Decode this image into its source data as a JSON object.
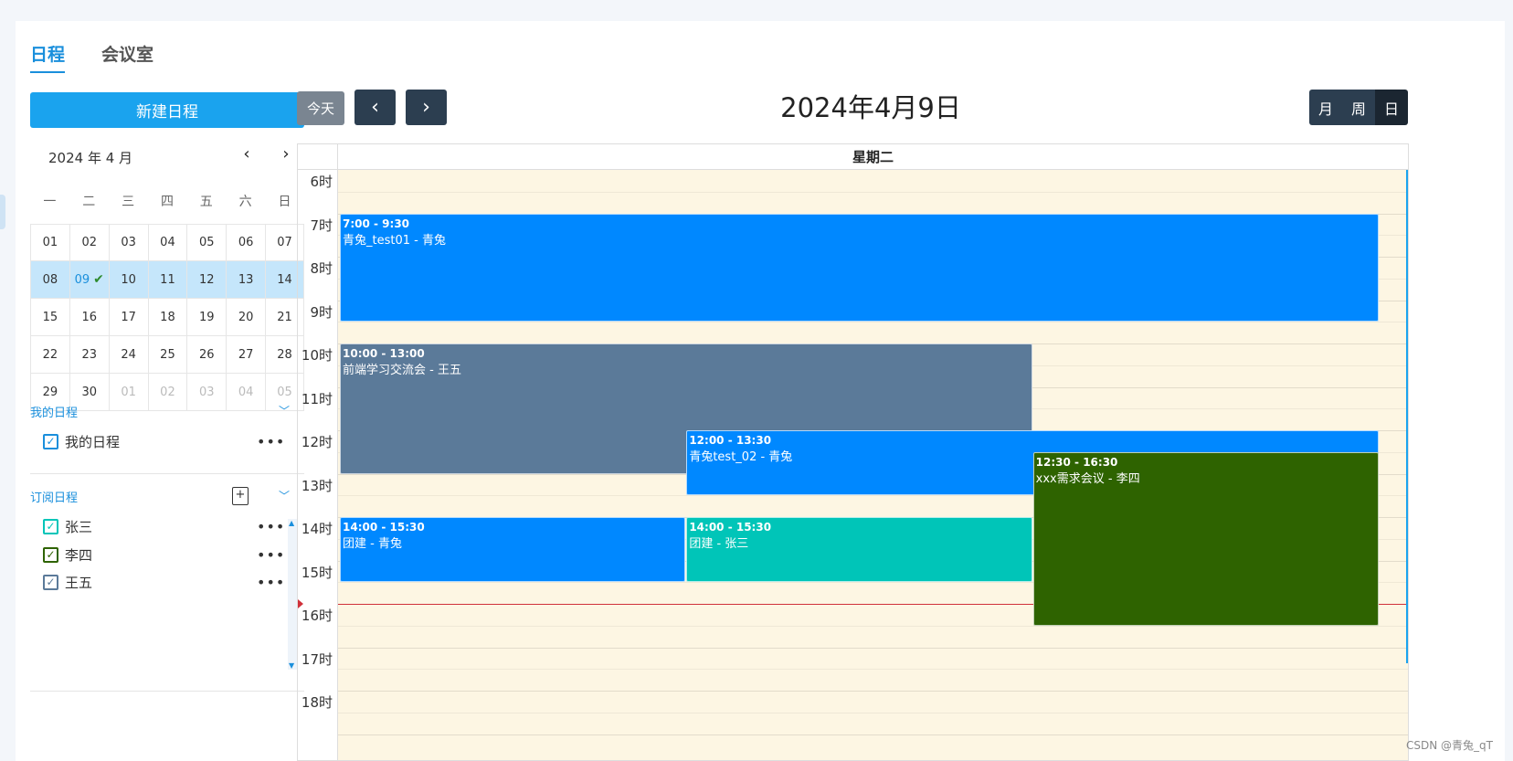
{
  "tabs": [
    {
      "label": "日程"
    },
    {
      "label": "会议室"
    }
  ],
  "new_button": "新建日程",
  "toolbar": {
    "today": "今天",
    "prev": "‹",
    "next": "›",
    "title": "2024年4月9日",
    "views": [
      "月",
      "周",
      "日"
    ]
  },
  "mini": {
    "title": "2024 年 4 月",
    "prev": "‹",
    "next": "›",
    "weekdays": [
      "一",
      "二",
      "三",
      "四",
      "五",
      "六",
      "日"
    ],
    "weeks": [
      [
        "01",
        "02",
        "03",
        "04",
        "05",
        "06",
        "07"
      ],
      [
        "08",
        "09",
        "10",
        "11",
        "12",
        "13",
        "14"
      ],
      [
        "15",
        "16",
        "17",
        "18",
        "19",
        "20",
        "21"
      ],
      [
        "22",
        "23",
        "24",
        "25",
        "26",
        "27",
        "28"
      ],
      [
        "29",
        "30",
        "01",
        "02",
        "03",
        "04",
        "05"
      ]
    ]
  },
  "my_section": {
    "title": "我的日程",
    "items": [
      {
        "label": "我的日程",
        "color": "#1a8fdc"
      }
    ]
  },
  "sub_section": {
    "title": "订阅日程",
    "items": [
      {
        "label": "张三",
        "color": "#00c5b8"
      },
      {
        "label": "李四",
        "color": "#2e6300"
      },
      {
        "label": "王五",
        "color": "#5b7a99"
      }
    ]
  },
  "day_header": "星期二",
  "hours": [
    "6时",
    "7时",
    "8时",
    "9时",
    "10时",
    "11时",
    "12时",
    "13时",
    "14时",
    "15时",
    "16时",
    "17时",
    "18时"
  ],
  "events": [
    {
      "time": "7:00 - 9:30",
      "title": "青兔_test01 - 青兔",
      "color": "#0088ff"
    },
    {
      "time": "10:00 - 13:00",
      "title": "前端学习交流会 - 王五",
      "color": "#5b7a99"
    },
    {
      "time": "12:00 - 13:30",
      "title": "青兔test_02 - 青兔",
      "color": "#0088ff"
    },
    {
      "time": "12:30 - 16:30",
      "title": "xxx需求会议 - 李四",
      "color": "#2e6300"
    },
    {
      "time": "14:00 - 15:30",
      "title": "团建 - 青兔",
      "color": "#0088ff"
    },
    {
      "time": "14:00 - 15:30",
      "title": "团建 - 张三",
      "color": "#00c5b8"
    }
  ],
  "watermark": "CSDN @青兔_qT"
}
